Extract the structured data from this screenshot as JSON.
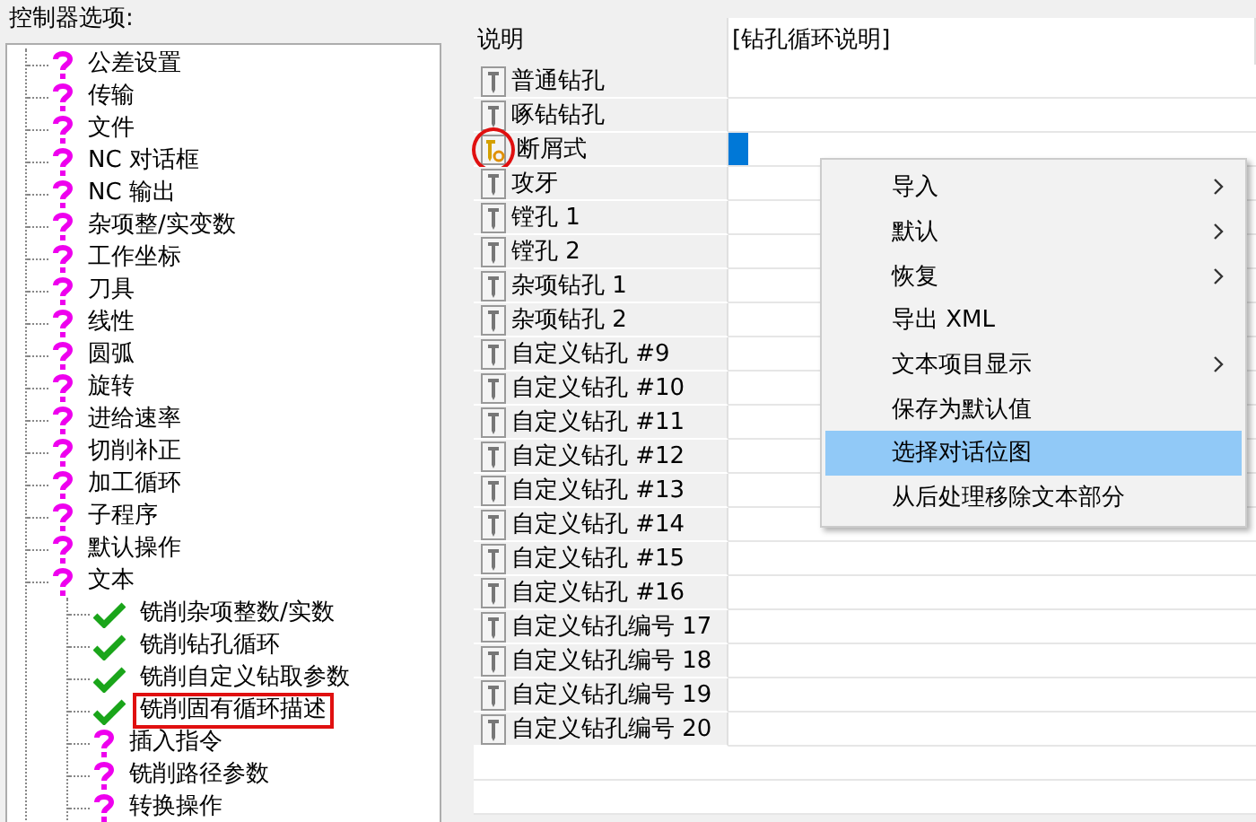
{
  "tree_label": "控制器选项:",
  "tree": {
    "items": [
      {
        "label": "公差设置",
        "kind": "question",
        "annotated": false
      },
      {
        "label": "传输",
        "kind": "question",
        "annotated": false
      },
      {
        "label": "文件",
        "kind": "question",
        "annotated": false
      },
      {
        "label": "NC 对话框",
        "kind": "question",
        "annotated": false
      },
      {
        "label": "NC 输出",
        "kind": "question",
        "annotated": false
      },
      {
        "label": "杂项整/实变数",
        "kind": "question",
        "annotated": false
      },
      {
        "label": "工作坐标",
        "kind": "question",
        "annotated": false
      },
      {
        "label": "刀具",
        "kind": "question",
        "annotated": false
      },
      {
        "label": "线性",
        "kind": "question",
        "annotated": false
      },
      {
        "label": "圆弧",
        "kind": "question",
        "annotated": false
      },
      {
        "label": "旋转",
        "kind": "question",
        "annotated": false
      },
      {
        "label": "进给速率",
        "kind": "question",
        "annotated": false
      },
      {
        "label": "切削补正",
        "kind": "question",
        "annotated": false
      },
      {
        "label": "加工循环",
        "kind": "question",
        "annotated": false
      },
      {
        "label": "子程序",
        "kind": "question",
        "annotated": false
      },
      {
        "label": "默认操作",
        "kind": "question",
        "annotated": false
      },
      {
        "label": "文本",
        "kind": "question",
        "annotated": false,
        "children": [
          {
            "label": "铣削杂项整数/实数",
            "kind": "check",
            "annotated": false
          },
          {
            "label": "铣削钻孔循环",
            "kind": "check",
            "annotated": false
          },
          {
            "label": "铣削自定义钻取参数",
            "kind": "check",
            "annotated": false
          },
          {
            "label": "铣削固有循环描述",
            "kind": "check",
            "annotated": true
          },
          {
            "label": "插入指令",
            "kind": "question",
            "annotated": false
          },
          {
            "label": "铣削路径参数",
            "kind": "question",
            "annotated": false
          },
          {
            "label": "转换操作",
            "kind": "question",
            "annotated": false
          }
        ]
      }
    ]
  },
  "table": {
    "columns": [
      "说明",
      "[钻孔循环说明]"
    ],
    "rows": [
      {
        "label": "普通钻孔",
        "kind": "drill",
        "annotated": false,
        "editing": false
      },
      {
        "label": "啄钻钻孔",
        "kind": "drill",
        "annotated": false,
        "editing": false
      },
      {
        "label": "断屑式",
        "kind": "custom",
        "annotated": true,
        "editing": true
      },
      {
        "label": "攻牙",
        "kind": "drill",
        "annotated": false,
        "editing": false
      },
      {
        "label": "镗孔 1",
        "kind": "drill",
        "annotated": false,
        "editing": false
      },
      {
        "label": "镗孔 2",
        "kind": "drill",
        "annotated": false,
        "editing": false
      },
      {
        "label": "杂项钻孔 1",
        "kind": "drill",
        "annotated": false,
        "editing": false
      },
      {
        "label": "杂项钻孔 2",
        "kind": "drill",
        "annotated": false,
        "editing": false
      },
      {
        "label": "自定义钻孔 #9",
        "kind": "drill",
        "annotated": false,
        "editing": false
      },
      {
        "label": "自定义钻孔 #10",
        "kind": "drill",
        "annotated": false,
        "editing": false
      },
      {
        "label": "自定义钻孔 #11",
        "kind": "drill",
        "annotated": false,
        "editing": false
      },
      {
        "label": "自定义钻孔 #12",
        "kind": "drill",
        "annotated": false,
        "editing": false
      },
      {
        "label": "自定义钻孔 #13",
        "kind": "drill",
        "annotated": false,
        "editing": false
      },
      {
        "label": "自定义钻孔 #14",
        "kind": "drill",
        "annotated": false,
        "editing": false
      },
      {
        "label": "自定义钻孔 #15",
        "kind": "drill",
        "annotated": false,
        "editing": false
      },
      {
        "label": "自定义钻孔 #16",
        "kind": "drill",
        "annotated": false,
        "editing": false
      },
      {
        "label": "自定义钻孔编号 17",
        "kind": "drill",
        "annotated": false,
        "editing": false
      },
      {
        "label": "自定义钻孔编号 18",
        "kind": "drill",
        "annotated": false,
        "editing": false
      },
      {
        "label": "自定义钻孔编号 19",
        "kind": "drill",
        "annotated": false,
        "editing": false
      },
      {
        "label": "自定义钻孔编号 20",
        "kind": "drill",
        "annotated": false,
        "editing": false
      }
    ]
  },
  "context_menu": {
    "items": [
      {
        "label": "导入",
        "submenu": true,
        "selected": false
      },
      {
        "label": "默认",
        "submenu": true,
        "selected": false
      },
      {
        "label": "恢复",
        "submenu": true,
        "selected": false
      },
      {
        "label": "导出 XML",
        "submenu": false,
        "selected": false
      },
      {
        "label": "文本项目显示",
        "submenu": true,
        "selected": false
      },
      {
        "label": "保存为默认值",
        "submenu": false,
        "selected": false
      },
      {
        "label": "选择对话位图",
        "submenu": false,
        "selected": true
      },
      {
        "label": "从后处理移除文本部分",
        "submenu": false,
        "selected": false
      }
    ]
  }
}
